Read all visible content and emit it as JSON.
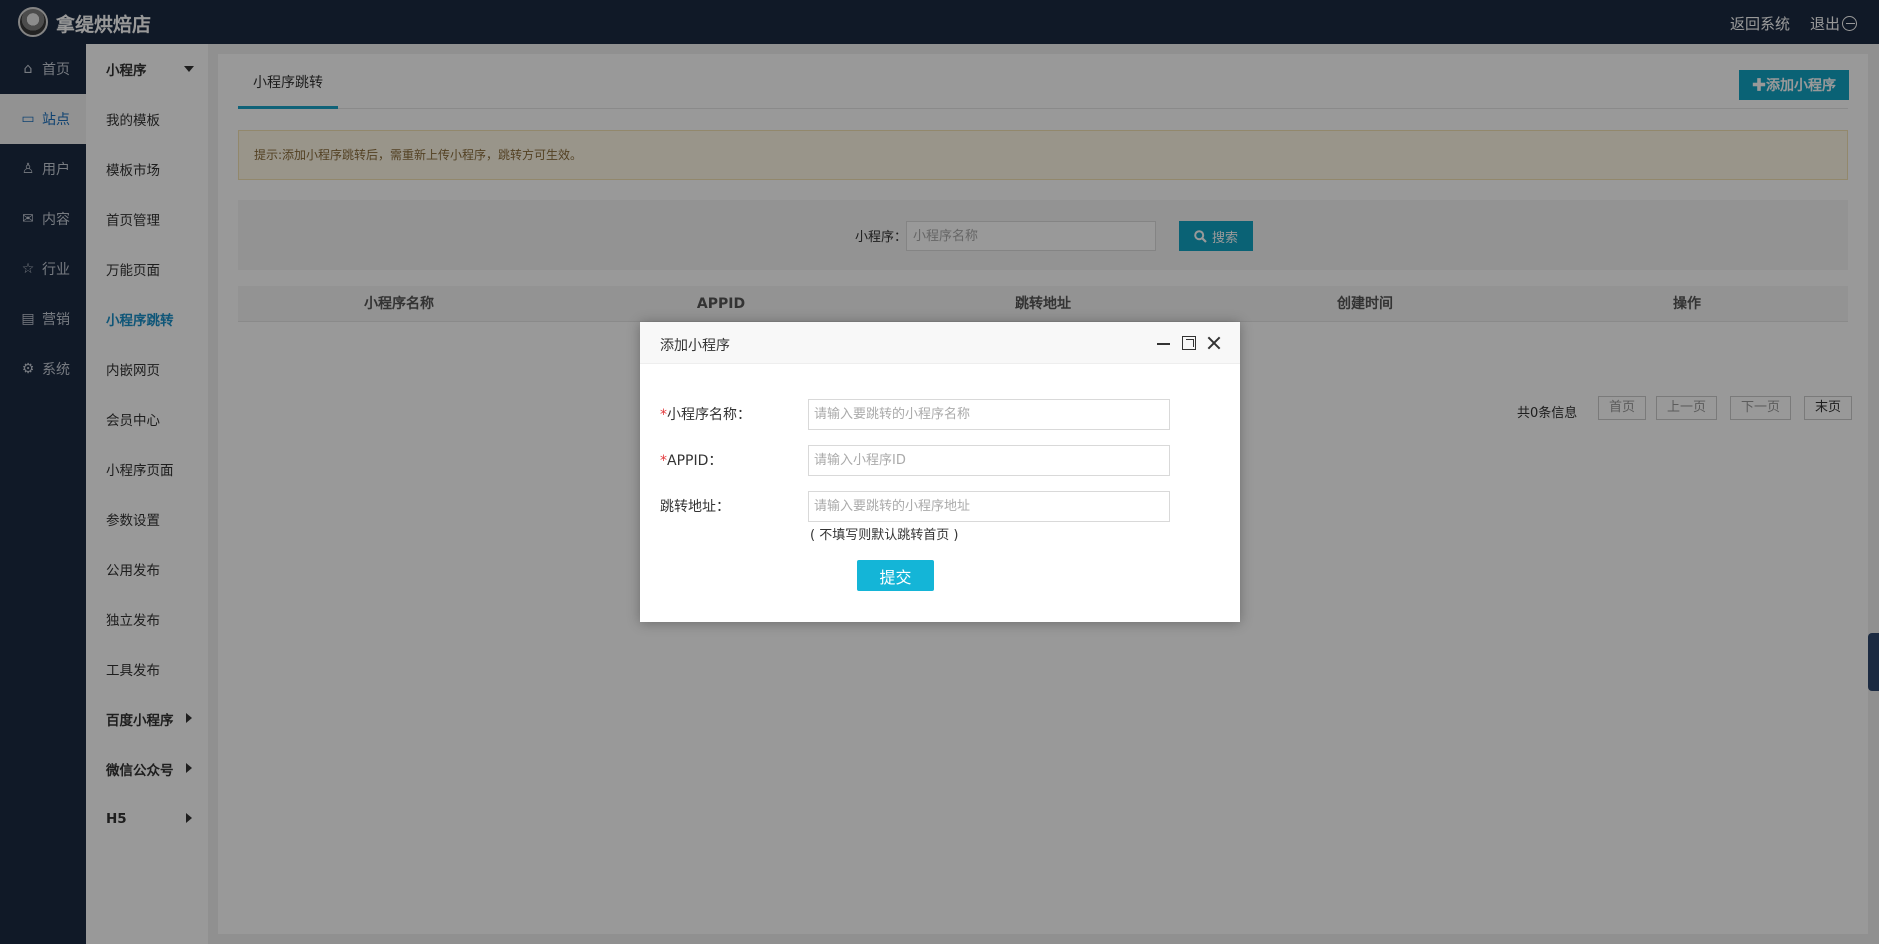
{
  "header": {
    "title": "拿缇烘焙店",
    "back_label": "返回系统",
    "logout_label": "退出"
  },
  "nav1": [
    {
      "label": "首页",
      "icon": "home-icon",
      "glyph": "⌂",
      "active": false
    },
    {
      "label": "站点",
      "icon": "monitor-icon",
      "glyph": "▭",
      "active": true
    },
    {
      "label": "用户",
      "icon": "user-icon",
      "glyph": "♙",
      "active": false
    },
    {
      "label": "内容",
      "icon": "inbox-icon",
      "glyph": "✉",
      "active": false
    },
    {
      "label": "行业",
      "icon": "star-icon",
      "glyph": "☆",
      "active": false
    },
    {
      "label": "营销",
      "icon": "calendar-icon",
      "glyph": "▤",
      "active": false
    },
    {
      "label": "系统",
      "icon": "gear-icon",
      "glyph": "⚙",
      "active": false
    }
  ],
  "nav2": [
    {
      "label": "小程序"
    },
    {
      "label": "我的模板"
    },
    {
      "label": "模板市场"
    },
    {
      "label": "首页管理"
    },
    {
      "label": "万能页面"
    },
    {
      "label": "小程序跳转"
    },
    {
      "label": "内嵌网页"
    },
    {
      "label": "会员中心"
    },
    {
      "label": "小程序页面"
    },
    {
      "label": "参数设置"
    },
    {
      "label": "公用发布"
    },
    {
      "label": "独立发布"
    },
    {
      "label": "工具发布"
    },
    {
      "label": "百度小程序"
    },
    {
      "label": "微信公众号"
    },
    {
      "label": "H5"
    }
  ],
  "main": {
    "tab_label": "小程序跳转",
    "add_button": "添加小程序",
    "tip": "提示:添加小程序跳转后，需重新上传小程序，跳转方可生效。",
    "search": {
      "label": "小程序：",
      "placeholder": "小程序名称",
      "button": "搜索"
    },
    "columns": [
      "小程序名称",
      "APPID",
      "跳转地址",
      "创建时间",
      "操作"
    ],
    "pager": {
      "total": "共0条信息",
      "first": "首页",
      "prev": "上一页",
      "next": "下一页",
      "last": "末页"
    }
  },
  "modal": {
    "title": "添加小程序",
    "required_mark": "*",
    "fields": [
      {
        "label": "小程序名称：",
        "placeholder": "请输入要跳转的小程序名称",
        "required": true
      },
      {
        "label": "APPID：",
        "placeholder": "请输入小程序ID",
        "required": true
      },
      {
        "label": "跳转地址：",
        "placeholder": "请输入要跳转的小程序地址",
        "required": false
      }
    ],
    "hint": "( 不填写则默认跳转首页 )",
    "submit": "提交"
  }
}
